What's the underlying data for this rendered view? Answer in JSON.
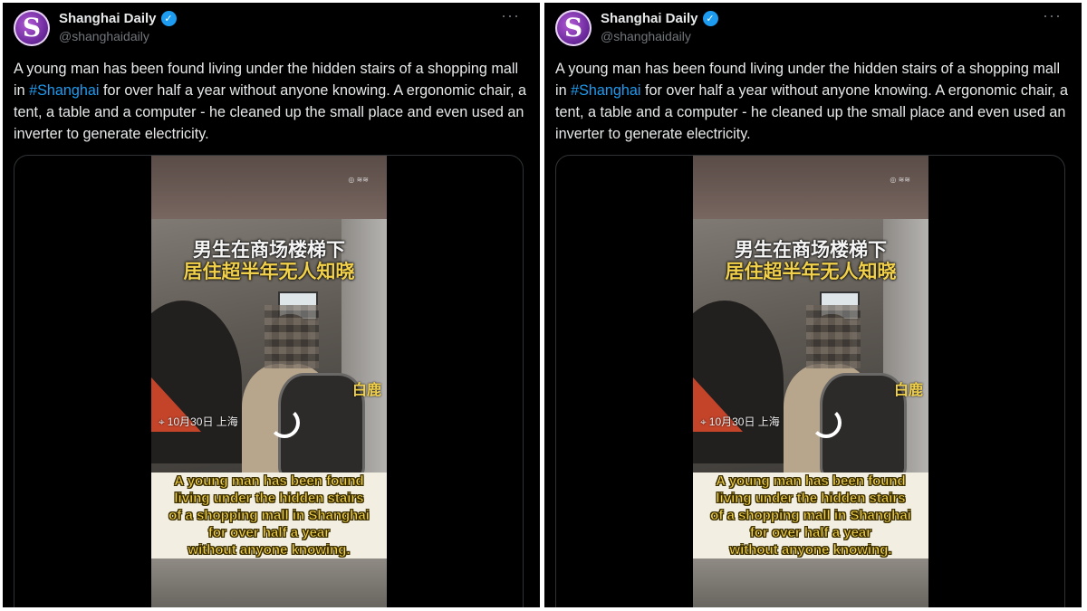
{
  "tweet": {
    "avatar_letter": "S",
    "display_name": "Shanghai Daily",
    "verified_glyph": "✓",
    "handle": "@shanghaidaily",
    "more_glyph": "···",
    "text_before": "A young man has been found living under the hidden stairs of a shopping mall in ",
    "hashtag": "#Shanghai",
    "text_after": " for over half a year without anyone knowing. A ergonomic chair, a tent, a table and a computer - he cleaned up the small place and even used an inverter to generate electricity."
  },
  "video": {
    "cn_title_line1": "男生在商场楼梯下",
    "cn_title_line2": "居住超半年无人知晓",
    "logo_text": "白鹿",
    "location_text": "10月30日 上海",
    "subtitle": "A young man has been found\nliving under the hidden stairs\nof a shopping mall in Shanghai\nfor over half a year\nwithout anyone knowing."
  },
  "icons": {
    "avatar": "shanghai-daily-logo-icon",
    "verified": "verified-badge-icon",
    "more": "more-options-icon",
    "location": "location-pin-icon"
  },
  "colors": {
    "background": "#000000",
    "text": "#e7e9ea",
    "muted": "#71767b",
    "accent": "#1d9bf0",
    "subtitle_yellow": "#f2d14a"
  }
}
